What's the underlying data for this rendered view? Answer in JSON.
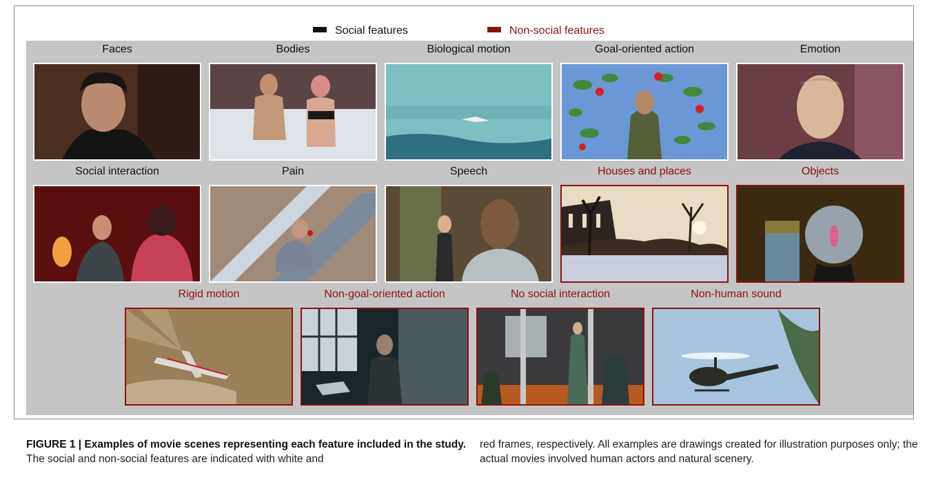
{
  "legend": {
    "social_label": "Social features",
    "social_color": "#111111",
    "nonsocial_label": "Non-social features",
    "nonsocial_color": "#8a1212"
  },
  "scenes": {
    "faces": "Faces",
    "bodies": "Bodies",
    "biological_motion": "Biological motion",
    "goal_action": "Goal-oriented action",
    "emotion": "Emotion",
    "social_interaction": "Social interaction",
    "pain": "Pain",
    "speech": "Speech",
    "houses": "Houses and places",
    "objects": "Objects",
    "rigid_motion": "Rigid motion",
    "nongoal_action": "Non-goal-oriented action",
    "no_social": "No social interaction",
    "nonhuman_sound": "Non-human sound"
  },
  "caption": {
    "bold": "FIGURE 1 | Examples of movie scenes representing each feature included in the study.",
    "left_rest": " The social and non-social features are indicated with white and",
    "right_text": "red frames, respectively. All examples are drawings created for illustration purposes only; the actual movies involved human actors and natural scenery."
  }
}
